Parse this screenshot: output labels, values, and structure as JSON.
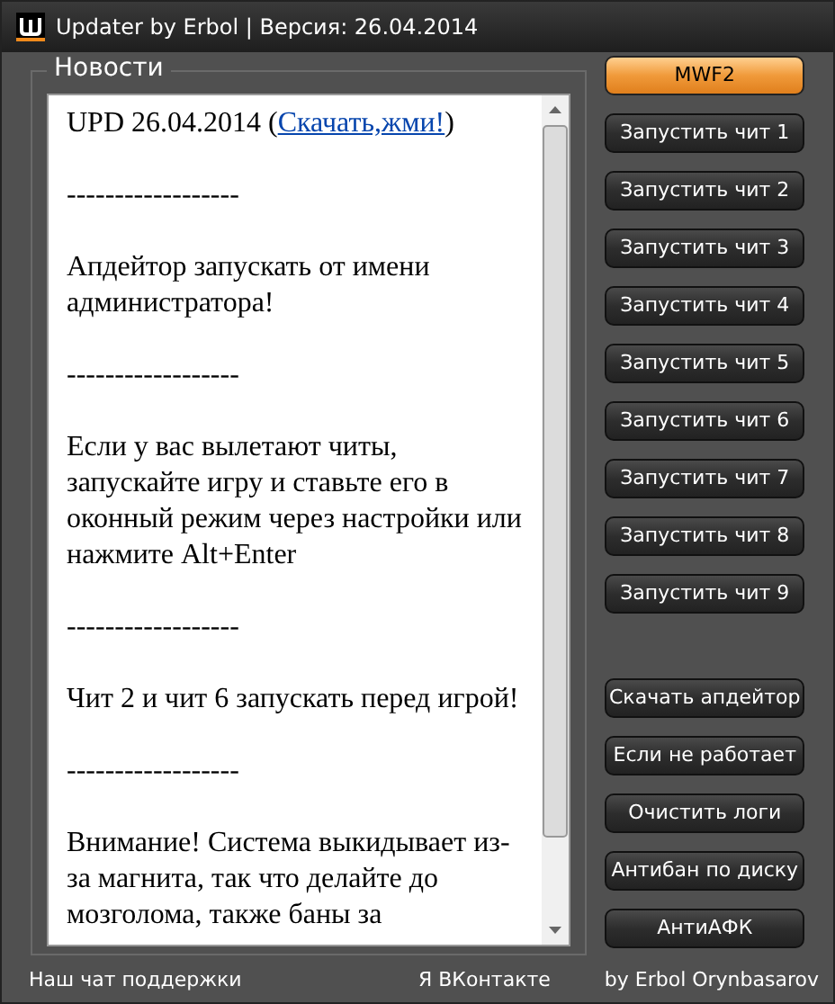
{
  "window": {
    "title": "Updater by Erbol | Версия: 26.04.2014"
  },
  "news": {
    "title": "Новости",
    "paragraphs": [
      {
        "text": "UPD 26.04.2014 (",
        "link": "Скачать,жми!",
        "after": ")"
      },
      {
        "text": "------------------"
      },
      {
        "text": "Апдейтор запускать от имени администратора!"
      },
      {
        "text": "------------------"
      },
      {
        "text": "Если у вас вылетают читы, запускайте игру и ставьте его в оконный режим через настройки или нажмите Alt+Enter"
      },
      {
        "text": "------------------"
      },
      {
        "text": "Чит 2 и чит 6 запускать перед игрой!"
      },
      {
        "text": "------------------"
      },
      {
        "text": "Внимание! Система выкидывает из-за магнита, так что делайте до мозголома, также баны за"
      }
    ]
  },
  "game_buttons": [
    {
      "label": "MWF2",
      "selected": true
    },
    {
      "label": "Запустить чит 1",
      "selected": false
    },
    {
      "label": "Запустить чит 2",
      "selected": false
    },
    {
      "label": "Запустить чит 3",
      "selected": false
    },
    {
      "label": "Запустить чит 4",
      "selected": false
    },
    {
      "label": "Запустить чит 5",
      "selected": false
    },
    {
      "label": "Запустить чит 6",
      "selected": false
    },
    {
      "label": "Запустить чит 7",
      "selected": false
    },
    {
      "label": "Запустить чит 8",
      "selected": false
    },
    {
      "label": "Запустить чит 9",
      "selected": false
    }
  ],
  "tool_buttons": [
    "Скачать апдейтор",
    "Если не работает",
    "Очистить логи",
    "Антибан по диску",
    "АнтиАФК"
  ],
  "footer": {
    "support_link": "Наш чат поддержки",
    "vk_link": "Я ВКонтакте",
    "credit": "by Erbol Orynbasarov"
  }
}
